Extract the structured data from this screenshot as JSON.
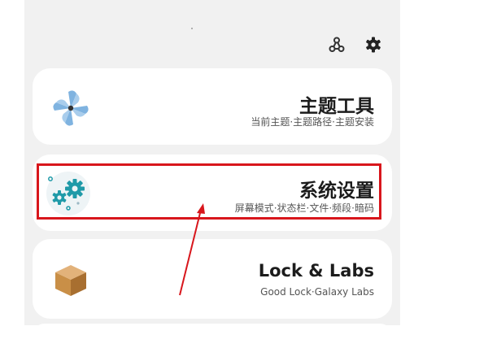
{
  "toolbar": {
    "icons": [
      "share-nodes-icon",
      "gear-icon"
    ]
  },
  "cards": [
    {
      "id": "theme",
      "title": "主题工具",
      "subtitle": "当前主题·主题路径·主题安装",
      "icon": "pinwheel-icon"
    },
    {
      "id": "system",
      "title": "系统设置",
      "subtitle": "屏幕模式·状态栏·文件·频段·暗码",
      "icon": "gears-icon"
    },
    {
      "id": "labs",
      "title": "Lock & Labs",
      "subtitle": "Good Lock·Galaxy Labs",
      "icon": "box-icon"
    }
  ],
  "annotation": {
    "highlight_color": "#d8161c",
    "highlighted_card": "system"
  },
  "colors": {
    "background": "#f1f1f1",
    "card": "#ffffff",
    "pinwheel": "#7fb3e0",
    "gear": "#1f9aa8",
    "box": "#c98f47"
  }
}
